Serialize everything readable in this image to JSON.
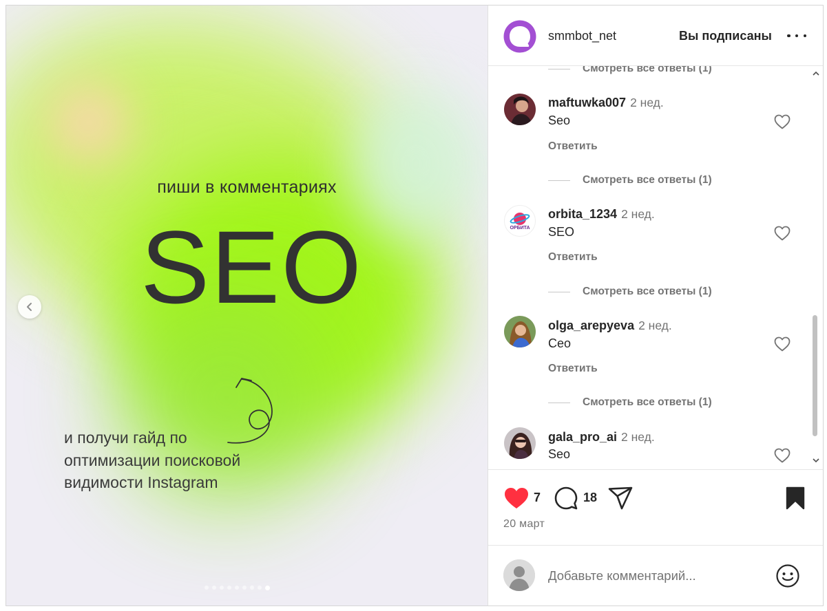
{
  "media": {
    "headline": "пиши в комментариях",
    "big_text": "SEO",
    "body_lines": [
      "и получи гайд по",
      "оптимизации поисковой",
      "видимости Instagram"
    ],
    "prev_icon": "chevron-left-icon",
    "slide_count": 9,
    "active_slide": 9
  },
  "header": {
    "username": "smmbot_net",
    "follow_label": "Вы подписаны",
    "more_icon": "more-horizontal-icon"
  },
  "comments": {
    "top_view_replies": "Смотреть все ответы (1)",
    "items": [
      {
        "username": "maftuwka007",
        "time": "2 нед.",
        "text": "Seo",
        "reply_label": "Ответить",
        "view_replies": "Смотреть все ответы (1)"
      },
      {
        "username": "orbita_1234",
        "time": "2 нед.",
        "text": "SEO",
        "reply_label": "Ответить",
        "view_replies": "Смотреть все ответы (1)",
        "avatar_text": "ОРБИТА"
      },
      {
        "username": "olga_arepyeva",
        "time": "2 нед.",
        "text": "Сео",
        "reply_label": "Ответить",
        "view_replies": "Смотреть все ответы (1)"
      },
      {
        "username": "gala_pro_ai",
        "time": "2 нед.",
        "text": "Seo"
      }
    ]
  },
  "actions": {
    "like_count": "7",
    "comment_count": "18",
    "date": "20 март",
    "liked": true,
    "saved": true
  },
  "composer": {
    "placeholder": "Добавьте комментарий..."
  },
  "colors": {
    "like_red": "#ff3040",
    "brand_purple": "#a34fd3",
    "text_primary": "#262626",
    "text_secondary": "#737373"
  }
}
